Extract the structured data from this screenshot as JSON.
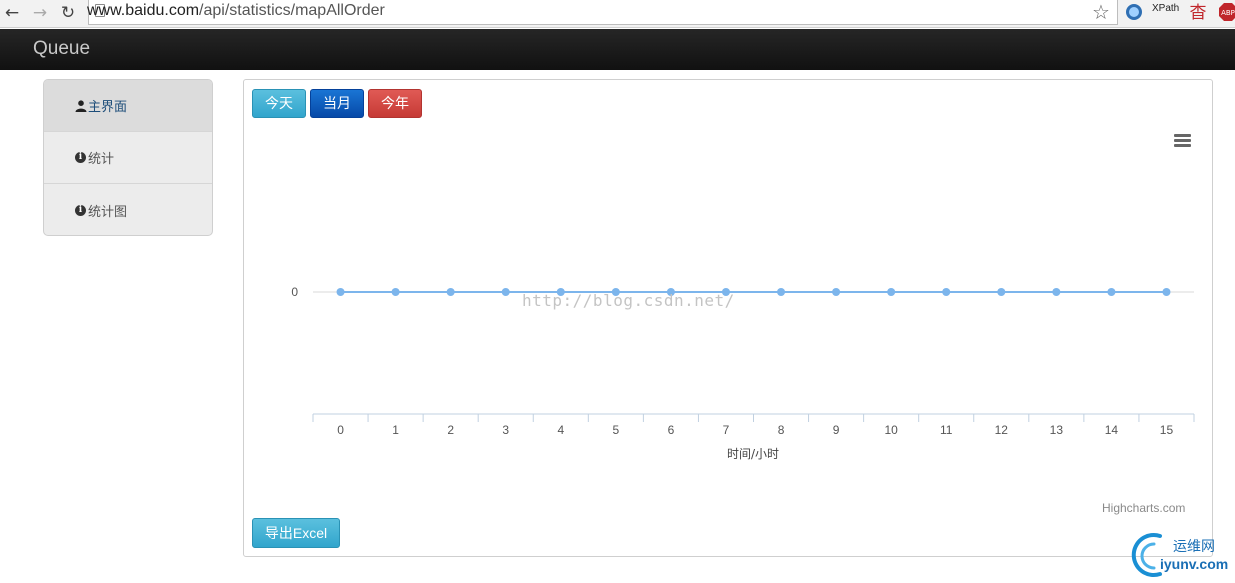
{
  "browser": {
    "url_host": "www.baidu.com",
    "url_path": "/api/statistics/mapAllOrder",
    "extensions": [
      "XPath",
      "杳",
      "ABP"
    ]
  },
  "app": {
    "brand": "Queue"
  },
  "sidebar": {
    "items": [
      {
        "label": "主界面",
        "icon": "user-icon",
        "active": true
      },
      {
        "label": "统计",
        "icon": "info-icon",
        "active": false
      },
      {
        "label": "统计图",
        "icon": "info-icon",
        "active": false
      }
    ]
  },
  "toolbar": {
    "today_label": "今天",
    "month_label": "当月",
    "year_label": "今年",
    "export_label": "导出Excel"
  },
  "chart_data": {
    "type": "line",
    "title": "",
    "xlabel": "时间/小时",
    "ylabel": "",
    "categories": [
      "0",
      "1",
      "2",
      "3",
      "4",
      "5",
      "6",
      "7",
      "8",
      "9",
      "10",
      "11",
      "12",
      "13",
      "14",
      "15"
    ],
    "series": [
      {
        "values": [
          0,
          0,
          0,
          0,
          0,
          0,
          0,
          0,
          0,
          0,
          0,
          0,
          0,
          0,
          0,
          0
        ]
      }
    ],
    "y_ticks": [
      "0"
    ],
    "grid": true,
    "legend": "none",
    "series_color": "#7cb5ec",
    "credits": "Highcharts.com",
    "watermark": "http://blog.csdn.net/"
  },
  "corner_logo": {
    "text_top": "运维网",
    "text_bottom": "iyunv.com"
  }
}
